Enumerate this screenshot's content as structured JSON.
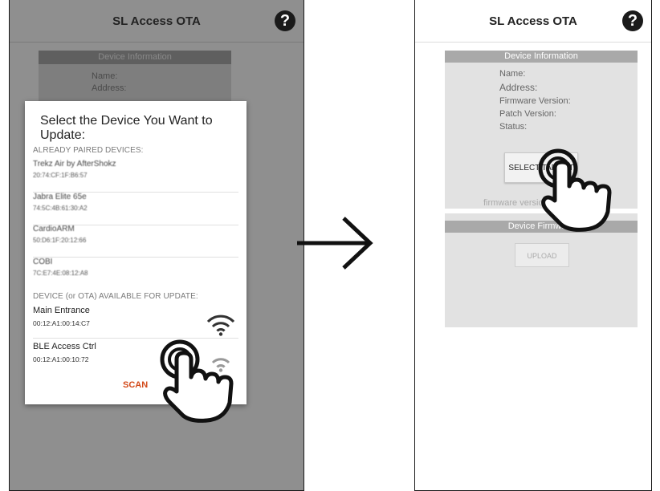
{
  "left_screen": {
    "app_title": "SL Access OTA",
    "help_icon": "?",
    "background_panel": {
      "header": "Device Information",
      "labels": [
        "Name:",
        "Address:"
      ]
    },
    "dialog": {
      "title": "Select the Device You Want to Update:",
      "paired_section": "ALREADY PAIRED DEVICES:",
      "paired_devices": [
        {
          "name": "Trekz Air by AfterShokz",
          "address": "20:74:CF:1F:B6:57"
        },
        {
          "name": "Jabra Elite 65e",
          "address": "74:5C:4B:61:30:A2"
        },
        {
          "name": "CardioARM",
          "address": "50:D6:1F:20:12:66"
        },
        {
          "name": "COBI",
          "address": "7C:E7:4E:08:12:A8"
        }
      ],
      "ota_section": "DEVICE (or OTA) AVAILABLE FOR UPDATE:",
      "ota_devices": [
        {
          "name": "Main Entrance",
          "address": "00:12:A1:00:14:C7"
        },
        {
          "name": "BLE Access Ctrl",
          "address": "00:12:A1:00:10:72"
        }
      ],
      "scan_label": "SCAN"
    }
  },
  "right_screen": {
    "app_title": "SL Access OTA",
    "help_icon": "?",
    "info_header": "Device Information",
    "labels": [
      "Name:",
      "Address:",
      "Firmware Version:",
      "Patch Version:",
      "Status:"
    ],
    "select_button": "SELECT TARGET",
    "firmware_version_text": "firmware version",
    "firmware_header": "Device Firmware",
    "upload_button": "UPLOAD"
  },
  "icons": [
    "help-icon",
    "wifi-icon",
    "arrow-right-icon",
    "pointing-hand-icon"
  ],
  "colors": {
    "dim_background": "#8f8f8f",
    "scan_accent": "#d34a1a",
    "panel_header": "#a9a9a9",
    "panel_body": "#e2e2e2"
  }
}
